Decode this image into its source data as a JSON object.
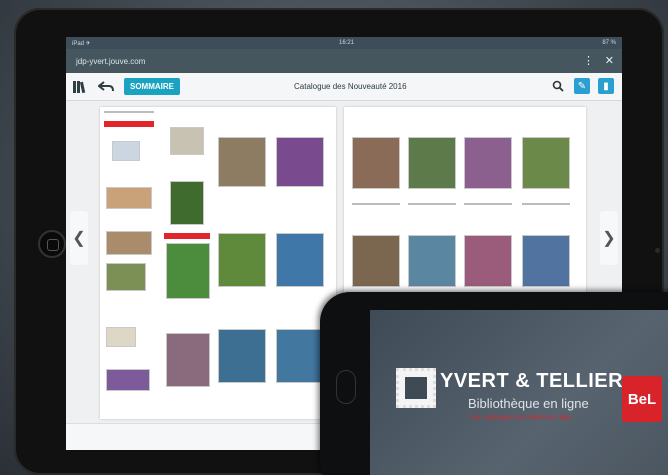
{
  "statusbar": {
    "left": "iPad ✈",
    "time": "16:21",
    "right": "87 %"
  },
  "browser": {
    "url": "jdp-yvert.jouve.com",
    "menu_icon": "kebab-icon",
    "close_icon": "close-icon"
  },
  "toolbar": {
    "library_icon": "library-icon",
    "back_icon": "back-arrow-icon",
    "sommaire_label": "SOMMAIRE",
    "title": "Catalogue des Nouveauté 2016",
    "search_icon": "search-icon",
    "edit_icon": "pencil-icon",
    "bookmark_icon": "bookmark-icon",
    "accent": "#1aa3c0",
    "edit_color": "#2a9fd0",
    "bookmark_color": "#2a9fd0"
  },
  "viewer": {
    "prev_icon": "chevron-left-icon",
    "next_icon": "chevron-right-icon",
    "bottom_back_icon": "back-arrow-icon"
  },
  "promo": {
    "brand": "YVERT & TELLIER",
    "subtitle": "Bibliothèque en ligne",
    "tagline": "Les catalogues de cotation en ligne",
    "badge": "BeL",
    "accent": "#d8232a"
  }
}
